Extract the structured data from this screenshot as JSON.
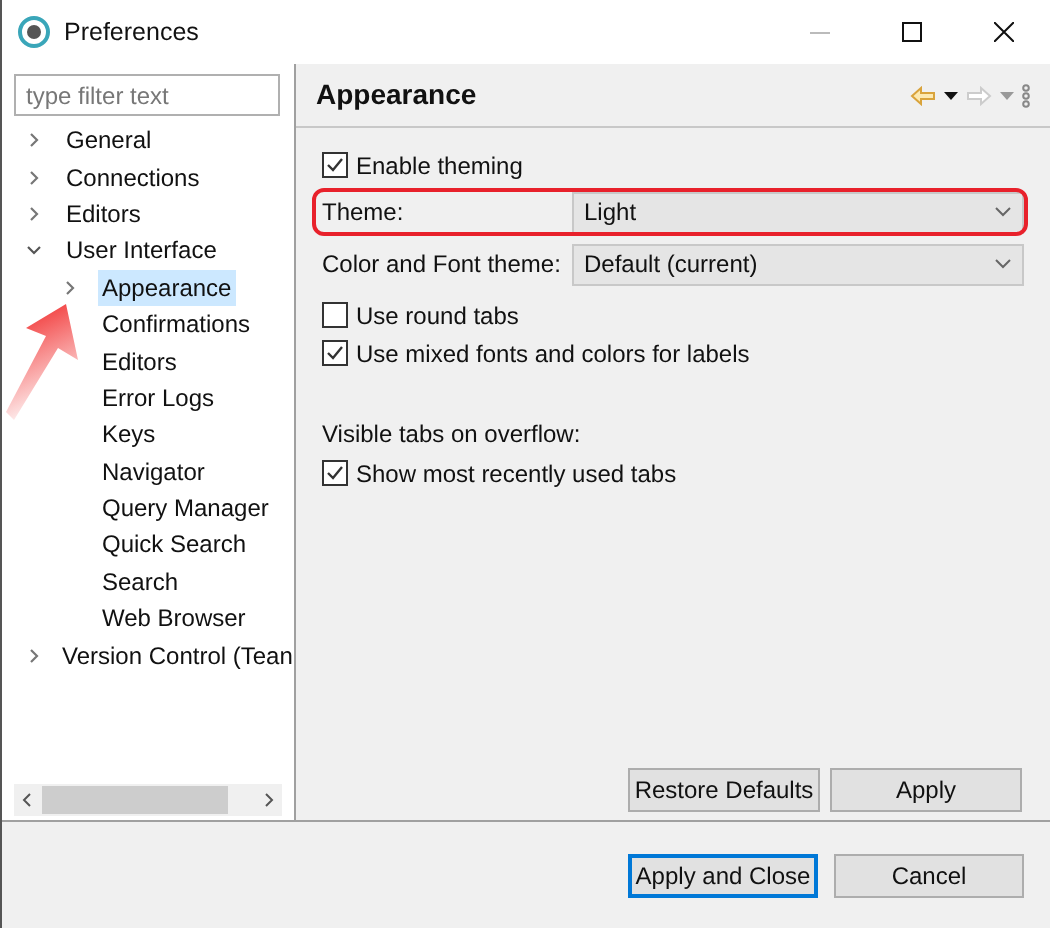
{
  "window": {
    "title": "Preferences"
  },
  "filter": {
    "placeholder": "type filter text"
  },
  "tree": [
    {
      "label": "General",
      "expanded": false,
      "selected": false
    },
    {
      "label": "Connections",
      "expanded": false,
      "selected": false
    },
    {
      "label": "Editors",
      "expanded": false,
      "selected": false
    },
    {
      "label": "User Interface",
      "expanded": true,
      "selected": false,
      "children": [
        {
          "label": "Appearance",
          "expanded": false,
          "selected": true
        },
        {
          "label": "Confirmations",
          "selected": false
        },
        {
          "label": "Editors",
          "selected": false
        },
        {
          "label": "Error Logs",
          "selected": false
        },
        {
          "label": "Keys",
          "selected": false
        },
        {
          "label": "Navigator",
          "selected": false
        },
        {
          "label": "Query Manager",
          "selected": false
        },
        {
          "label": "Quick Search",
          "selected": false
        },
        {
          "label": "Search",
          "selected": false
        },
        {
          "label": "Web Browser",
          "selected": false
        }
      ]
    },
    {
      "label": "Version Control (Tean",
      "expanded": false,
      "selected": false
    }
  ],
  "page": {
    "title": "Appearance",
    "enable_theming": {
      "label": "Enable theming",
      "checked": true
    },
    "theme": {
      "label": "Theme:",
      "value": "Light"
    },
    "color_font_theme": {
      "label": "Color and Font theme:",
      "value": "Default (current)"
    },
    "options": [
      {
        "label": "Use round tabs",
        "checked": false
      },
      {
        "label": "Use mixed fonts and colors for labels",
        "checked": true
      }
    ],
    "overflow_label": "Visible tabs on overflow:",
    "overflow_options": [
      {
        "label": "Show most recently used tabs",
        "checked": true
      }
    ],
    "buttons": [
      "Restore Defaults",
      "Apply"
    ]
  },
  "dialog_buttons": [
    {
      "label": "Apply and Close",
      "selected": true
    },
    {
      "label": "Cancel",
      "selected": false
    }
  ]
}
